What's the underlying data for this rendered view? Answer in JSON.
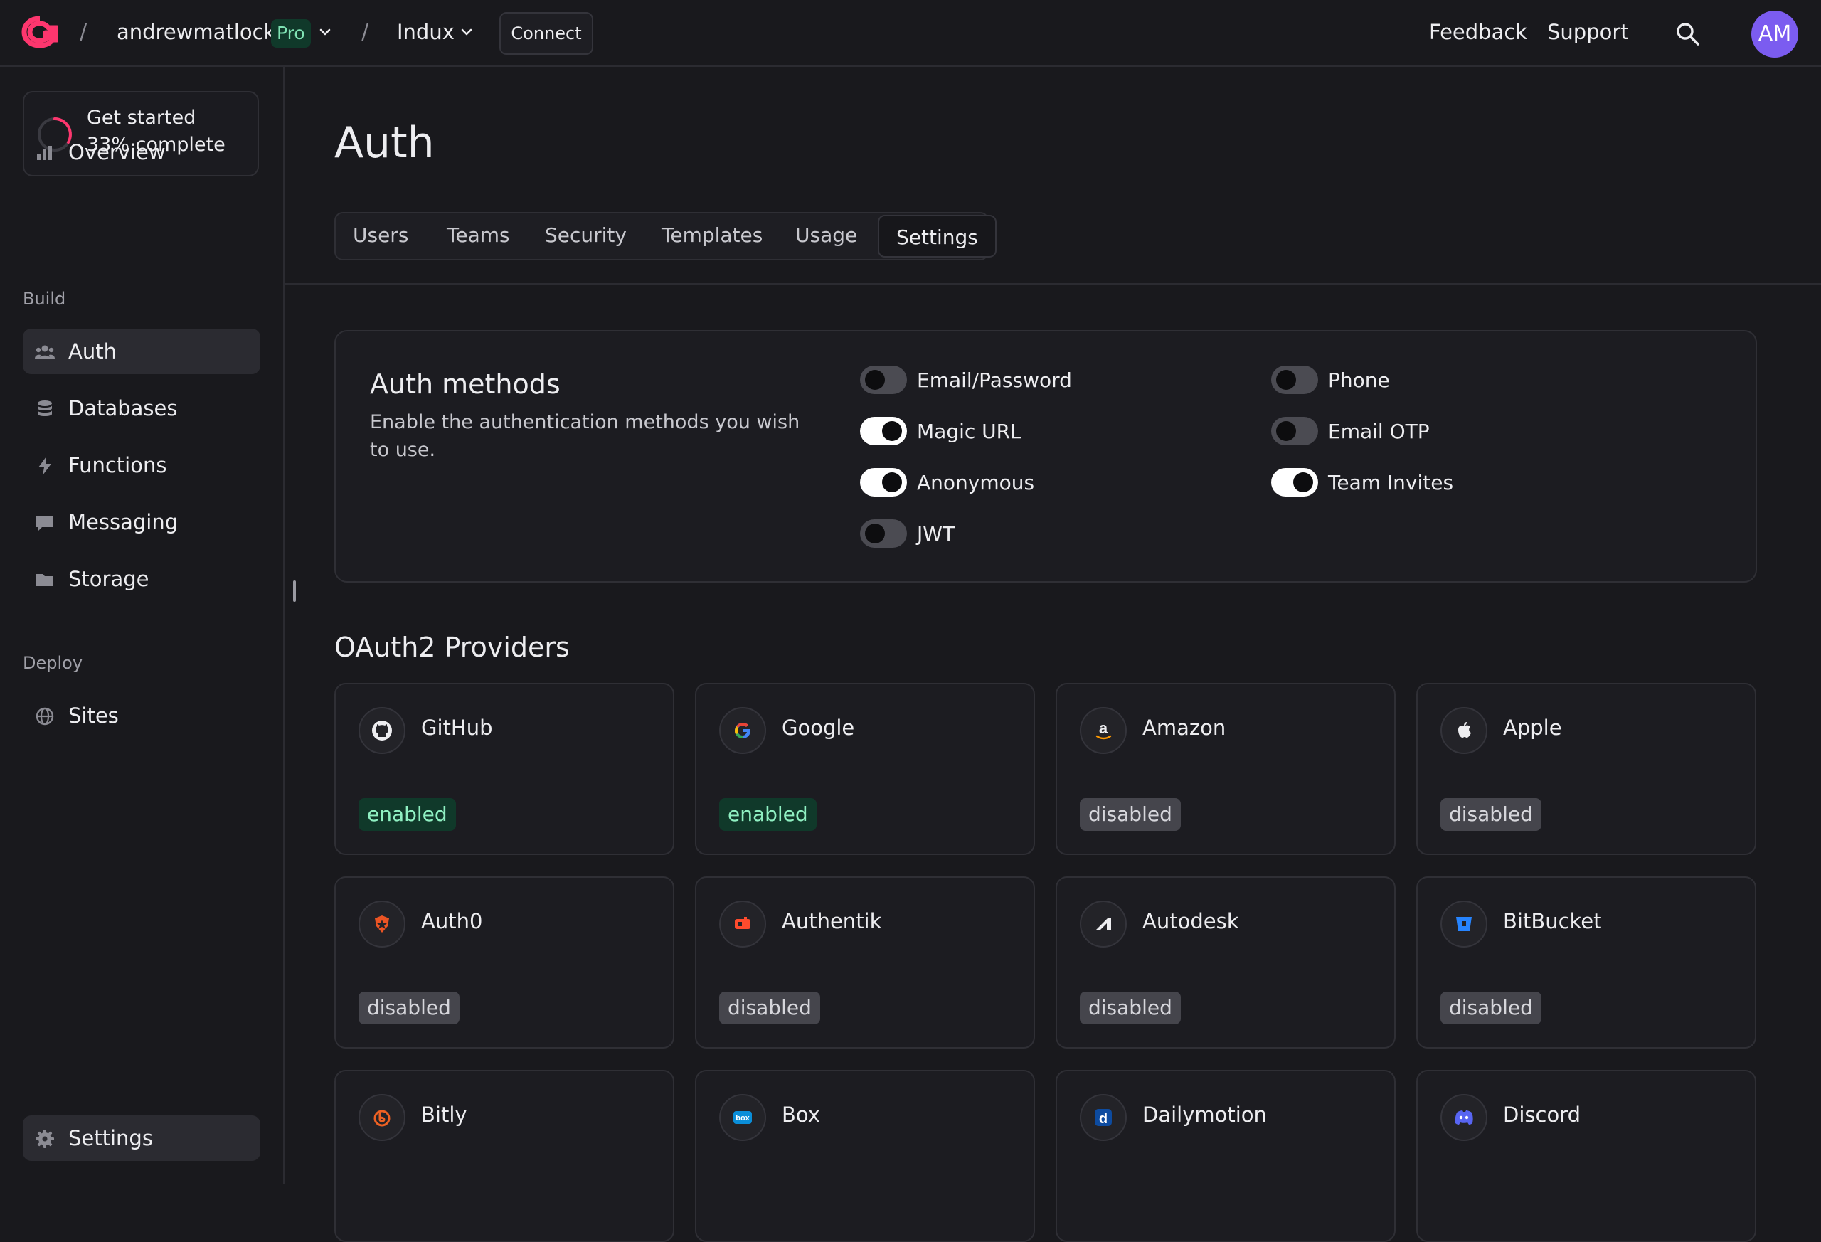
{
  "topbar": {
    "org": "andrewmatlock",
    "plan_badge": "Pro",
    "project": "Indux",
    "connect_label": "Connect",
    "feedback_label": "Feedback",
    "support_label": "Support",
    "avatar_initials": "AM",
    "brand_color": "#fd366e"
  },
  "sidebar": {
    "get_started": {
      "title": "Get started",
      "progress": "33% complete",
      "progress_value": 0.33
    },
    "overview": "Overview",
    "build_label": "Build",
    "build_items": [
      {
        "label": "Auth",
        "icon": "users-icon",
        "active": true
      },
      {
        "label": "Databases",
        "icon": "database-icon"
      },
      {
        "label": "Functions",
        "icon": "lightning-icon"
      },
      {
        "label": "Messaging",
        "icon": "chat-icon"
      },
      {
        "label": "Storage",
        "icon": "folder-icon"
      }
    ],
    "deploy_label": "Deploy",
    "deploy_items": [
      {
        "label": "Sites",
        "icon": "globe-icon"
      }
    ],
    "settings": "Settings"
  },
  "page": {
    "title": "Auth",
    "tabs": [
      "Users",
      "Teams",
      "Security",
      "Templates",
      "Usage",
      "Settings"
    ],
    "active_tab": "Settings"
  },
  "auth_methods": {
    "title": "Auth methods",
    "description": "Enable the authentication methods you wish to use.",
    "methods": [
      {
        "label": "Email/Password",
        "enabled": false
      },
      {
        "label": "Magic URL",
        "enabled": true
      },
      {
        "label": "Anonymous",
        "enabled": true
      },
      {
        "label": "JWT",
        "enabled": false
      },
      {
        "label": "Phone",
        "enabled": false
      },
      {
        "label": "Email OTP",
        "enabled": false
      },
      {
        "label": "Team Invites",
        "enabled": true
      }
    ]
  },
  "oauth": {
    "heading": "OAuth2 Providers",
    "providers": [
      {
        "name": "GitHub",
        "status": "enabled",
        "icon": "github-icon"
      },
      {
        "name": "Google",
        "status": "enabled",
        "icon": "google-icon"
      },
      {
        "name": "Amazon",
        "status": "disabled",
        "icon": "amazon-icon"
      },
      {
        "name": "Apple",
        "status": "disabled",
        "icon": "apple-icon"
      },
      {
        "name": "Auth0",
        "status": "disabled",
        "icon": "auth0-icon"
      },
      {
        "name": "Authentik",
        "status": "disabled",
        "icon": "authentik-icon"
      },
      {
        "name": "Autodesk",
        "status": "disabled",
        "icon": "autodesk-icon"
      },
      {
        "name": "BitBucket",
        "status": "disabled",
        "icon": "bitbucket-icon"
      },
      {
        "name": "Bitly",
        "status": "",
        "icon": "bitly-icon"
      },
      {
        "name": "Box",
        "status": "",
        "icon": "box-icon"
      },
      {
        "name": "Dailymotion",
        "status": "",
        "icon": "dailymotion-icon"
      },
      {
        "name": "Discord",
        "status": "",
        "icon": "discord-icon"
      }
    ]
  }
}
